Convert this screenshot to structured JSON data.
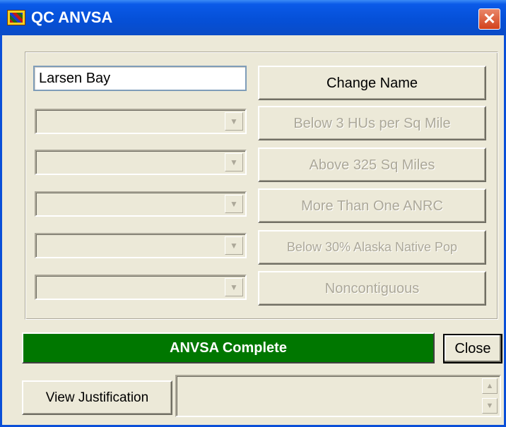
{
  "window": {
    "title": "QC ANVSA",
    "close_glyph": "✕"
  },
  "name_field": {
    "value": "Larsen Bay"
  },
  "buttons": {
    "change_name": "Change Name",
    "below_3_hus": "Below 3 HUs per Sq Mile",
    "above_325": "Above 325 Sq Miles",
    "more_than_one_anrc": "More Than One ANRC",
    "below_30_pct": "Below 30% Alaska Native Pop",
    "noncontiguous": "Noncontiguous"
  },
  "status": {
    "label": "ANVSA Complete",
    "color": "#007700"
  },
  "close_button": "Close",
  "view_justification": "View Justification",
  "icons": {
    "app": "app-icon",
    "dropdown": "chevron-down-icon",
    "scroll_up": "scroll-up-icon",
    "scroll_down": "scroll-down-icon"
  }
}
